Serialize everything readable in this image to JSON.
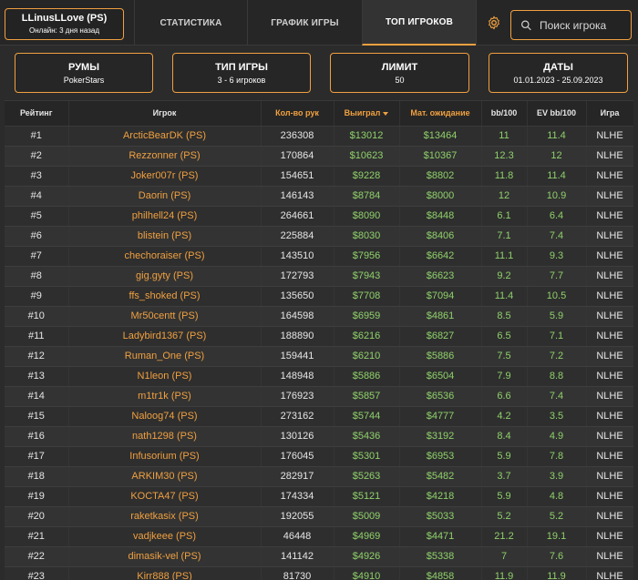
{
  "profile": {
    "name": "LLinusLLove (PS)",
    "status": "Онлайн: 3 дня назад"
  },
  "nav": {
    "stats": "СТАТИСТИКА",
    "graph": "ГРАФИК ИГРЫ",
    "top": "ТОП ИГРОКОВ",
    "active": "top"
  },
  "icons": {
    "settings": "gear-icon",
    "search": "search-icon",
    "sort": "sort-desc-icon"
  },
  "search": {
    "placeholder": "Поиск игрока"
  },
  "filters": {
    "rooms": {
      "title": "РУМЫ",
      "value": "PokerStars"
    },
    "game_type": {
      "title": "ТИП ИГРЫ",
      "value": "3 - 6 игроков"
    },
    "limit": {
      "title": "ЛИМИТ",
      "value": "50"
    },
    "dates": {
      "title": "ДАТЫ",
      "value": "01.01.2023 - 25.09.2023"
    }
  },
  "colors": {
    "accent": "#f0a040",
    "positive": "#8fd16a",
    "background": "#2b2b2b"
  },
  "table": {
    "headers": {
      "rank": "Рейтинг",
      "player": "Игрок",
      "hands": "Кол-во рук",
      "won": "Выиграл",
      "ev": "Мат. ожидание",
      "bb100": "bb/100",
      "evbb100": "EV bb/100",
      "game": "Игра"
    },
    "sorted_by": "won",
    "rows": [
      [
        "#1",
        "ArcticBearDK (PS)",
        "236308",
        "$13012",
        "$13464",
        "11",
        "11.4",
        "NLHE"
      ],
      [
        "#2",
        "Rezzonner (PS)",
        "170864",
        "$10623",
        "$10367",
        "12.3",
        "12",
        "NLHE"
      ],
      [
        "#3",
        "Joker007r (PS)",
        "154651",
        "$9228",
        "$8802",
        "11.8",
        "11.4",
        "NLHE"
      ],
      [
        "#4",
        "Daorin (PS)",
        "146143",
        "$8784",
        "$8000",
        "12",
        "10.9",
        "NLHE"
      ],
      [
        "#5",
        "philhell24 (PS)",
        "264661",
        "$8090",
        "$8448",
        "6.1",
        "6.4",
        "NLHE"
      ],
      [
        "#6",
        "blistein (PS)",
        "225884",
        "$8030",
        "$8406",
        "7.1",
        "7.4",
        "NLHE"
      ],
      [
        "#7",
        "chechoraiser (PS)",
        "143510",
        "$7956",
        "$6642",
        "11.1",
        "9.3",
        "NLHE"
      ],
      [
        "#8",
        "gig.gyty (PS)",
        "172793",
        "$7943",
        "$6623",
        "9.2",
        "7.7",
        "NLHE"
      ],
      [
        "#9",
        "ffs_shoked (PS)",
        "135650",
        "$7708",
        "$7094",
        "11.4",
        "10.5",
        "NLHE"
      ],
      [
        "#10",
        "Mr50centt (PS)",
        "164598",
        "$6959",
        "$4861",
        "8.5",
        "5.9",
        "NLHE"
      ],
      [
        "#11",
        "Ladybird1367 (PS)",
        "188890",
        "$6216",
        "$6827",
        "6.5",
        "7.1",
        "NLHE"
      ],
      [
        "#12",
        "Ruman_One (PS)",
        "159441",
        "$6210",
        "$5886",
        "7.5",
        "7.2",
        "NLHE"
      ],
      [
        "#13",
        "N1leon (PS)",
        "148948",
        "$5886",
        "$6504",
        "7.9",
        "8.8",
        "NLHE"
      ],
      [
        "#14",
        "m1tr1k (PS)",
        "176923",
        "$5857",
        "$6536",
        "6.6",
        "7.4",
        "NLHE"
      ],
      [
        "#15",
        "Naloog74 (PS)",
        "273162",
        "$5744",
        "$4777",
        "4.2",
        "3.5",
        "NLHE"
      ],
      [
        "#16",
        "nath1298 (PS)",
        "130126",
        "$5436",
        "$3192",
        "8.4",
        "4.9",
        "NLHE"
      ],
      [
        "#17",
        "Infusorium (PS)",
        "176045",
        "$5301",
        "$6953",
        "5.9",
        "7.8",
        "NLHE"
      ],
      [
        "#18",
        "ARKIM30 (PS)",
        "282917",
        "$5263",
        "$5482",
        "3.7",
        "3.9",
        "NLHE"
      ],
      [
        "#19",
        "KOCTA47 (PS)",
        "174334",
        "$5121",
        "$4218",
        "5.9",
        "4.8",
        "NLHE"
      ],
      [
        "#20",
        "raketkasix (PS)",
        "192055",
        "$5009",
        "$5033",
        "5.2",
        "5.2",
        "NLHE"
      ],
      [
        "#21",
        "vadjkeee (PS)",
        "46448",
        "$4969",
        "$4471",
        "21.2",
        "19.1",
        "NLHE"
      ],
      [
        "#22",
        "dimasik-vel (PS)",
        "141142",
        "$4926",
        "$5338",
        "7",
        "7.6",
        "NLHE"
      ],
      [
        "#23",
        "Kirr888 (PS)",
        "81730",
        "$4910",
        "$4858",
        "11.9",
        "11.9",
        "NLHE"
      ]
    ]
  }
}
